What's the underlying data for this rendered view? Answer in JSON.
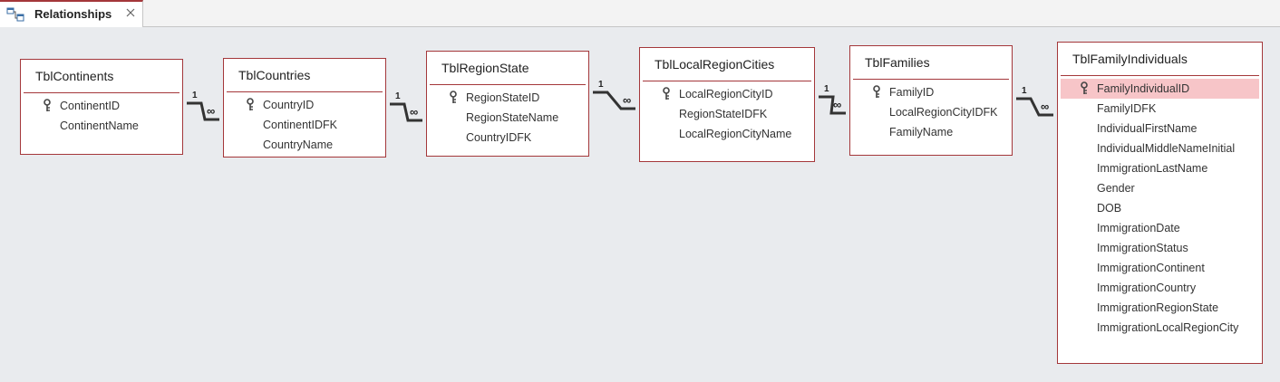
{
  "tab": {
    "icon": "relationships-icon",
    "label": "Relationships",
    "close_icon": "close-icon"
  },
  "colors": {
    "table_border": "#a4373a",
    "selected_row": "#f7c5c8",
    "canvas": "#e9ebee"
  },
  "tables": [
    {
      "name": "TblContinents",
      "fields": [
        {
          "name": "ContinentID",
          "key": true
        },
        {
          "name": "ContinentName",
          "key": false
        }
      ]
    },
    {
      "name": "TblCountries",
      "fields": [
        {
          "name": "CountryID",
          "key": true
        },
        {
          "name": "ContinentIDFK",
          "key": false
        },
        {
          "name": "CountryName",
          "key": false
        }
      ]
    },
    {
      "name": "TblRegionState",
      "fields": [
        {
          "name": "RegionStateID",
          "key": true
        },
        {
          "name": "RegionStateName",
          "key": false
        },
        {
          "name": "CountryIDFK",
          "key": false
        }
      ]
    },
    {
      "name": "TblLocalRegionCities",
      "fields": [
        {
          "name": "LocalRegionCityID",
          "key": true
        },
        {
          "name": "RegionStateIDFK",
          "key": false
        },
        {
          "name": "LocalRegionCityName",
          "key": false
        }
      ]
    },
    {
      "name": "TblFamilies",
      "fields": [
        {
          "name": "FamilyID",
          "key": true
        },
        {
          "name": "LocalRegionCityIDFK",
          "key": false
        },
        {
          "name": "FamilyName",
          "key": false
        }
      ]
    },
    {
      "name": "TblFamilyIndividuals",
      "fields": [
        {
          "name": "FamilyIndividualID",
          "key": true,
          "selected": true
        },
        {
          "name": "FamilyIDFK",
          "key": false
        },
        {
          "name": "IndividualFirstName",
          "key": false
        },
        {
          "name": "IndividualMiddleNameInitial",
          "key": false
        },
        {
          "name": "ImmigrationLastName",
          "key": false
        },
        {
          "name": "Gender",
          "key": false
        },
        {
          "name": "DOB",
          "key": false
        },
        {
          "name": "ImmigrationDate",
          "key": false
        },
        {
          "name": "ImmigrationStatus",
          "key": false
        },
        {
          "name": "ImmigrationContinent",
          "key": false
        },
        {
          "name": "ImmigrationCountry",
          "key": false
        },
        {
          "name": "ImmigrationRegionState",
          "key": false
        },
        {
          "name": "ImmigrationLocalRegionCity",
          "key": false
        }
      ]
    }
  ],
  "relationships": [
    {
      "from": "TblContinents",
      "to": "TblCountries",
      "one_label": "1",
      "many_label": "∞"
    },
    {
      "from": "TblCountries",
      "to": "TblRegionState",
      "one_label": "1",
      "many_label": "∞"
    },
    {
      "from": "TblRegionState",
      "to": "TblLocalRegionCities",
      "one_label": "1",
      "many_label": "∞"
    },
    {
      "from": "TblLocalRegionCities",
      "to": "TblFamilies",
      "one_label": "1",
      "many_label": "∞"
    },
    {
      "from": "TblFamilies",
      "to": "TblFamilyIndividuals",
      "one_label": "1",
      "many_label": "∞"
    }
  ]
}
